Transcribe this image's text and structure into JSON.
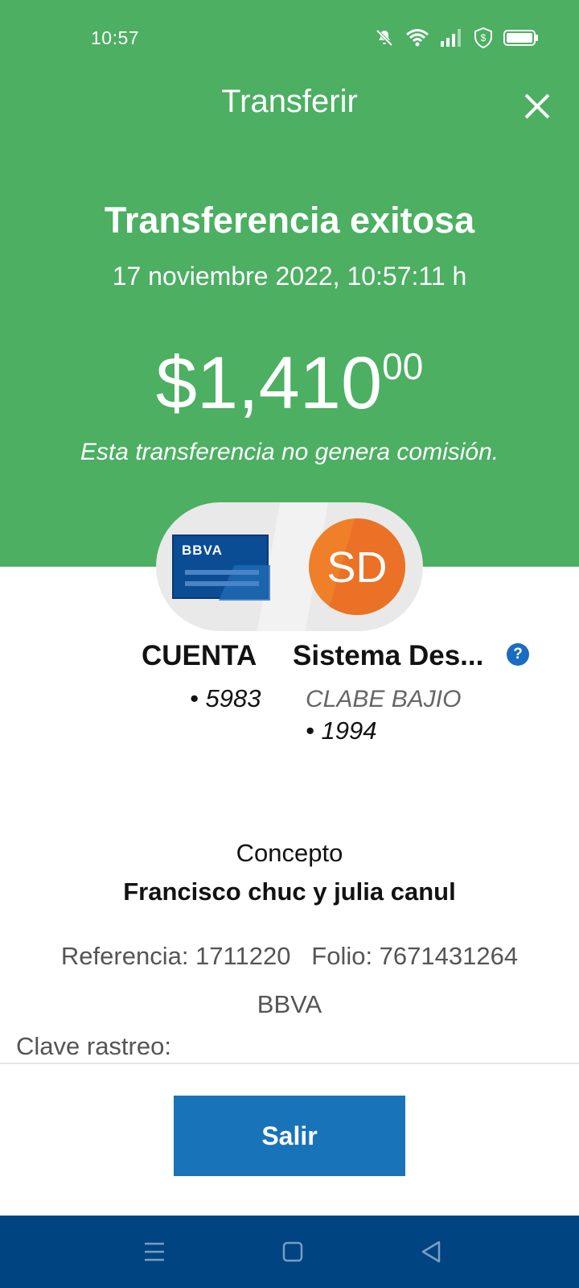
{
  "status_bar": {
    "time": "10:57",
    "icons": [
      "bell-muted-icon",
      "wifi-icon",
      "signal-icon",
      "shield-dollar-icon",
      "battery-icon"
    ]
  },
  "app_bar": {
    "title": "Transferir",
    "close_icon": "close-icon"
  },
  "result": {
    "headline": "Transferencia exitosa",
    "datetime": "17 noviembre 2022, 10:57:11 h",
    "amount_main": "$1,410",
    "amount_cents": "00",
    "commission_note": "Esta transferencia no genera comisión."
  },
  "origin": {
    "card_brand": "BBVA",
    "name": "CUENTA",
    "number": "• 5983"
  },
  "destination": {
    "initials": "SD",
    "name": "Sistema Des...",
    "bank": "CLABE BAJIO",
    "number": "• 1994",
    "help_icon": "?"
  },
  "details": {
    "concept_label": "Concepto",
    "concept_value": "Francisco chuc y julia canul",
    "reference": "Referencia: 1711220   Folio: 7671431264",
    "bank": "BBVA",
    "trace_label": "Clave rastreo:"
  },
  "actions": {
    "exit_label": "Salir"
  },
  "nav": {
    "icons": [
      "menu-icon",
      "home-icon",
      "back-icon"
    ]
  },
  "colors": {
    "header_green": "#4caf62",
    "primary_blue": "#1973b8",
    "navbar_blue": "#004481",
    "avatar_orange": "#f07f2a"
  }
}
